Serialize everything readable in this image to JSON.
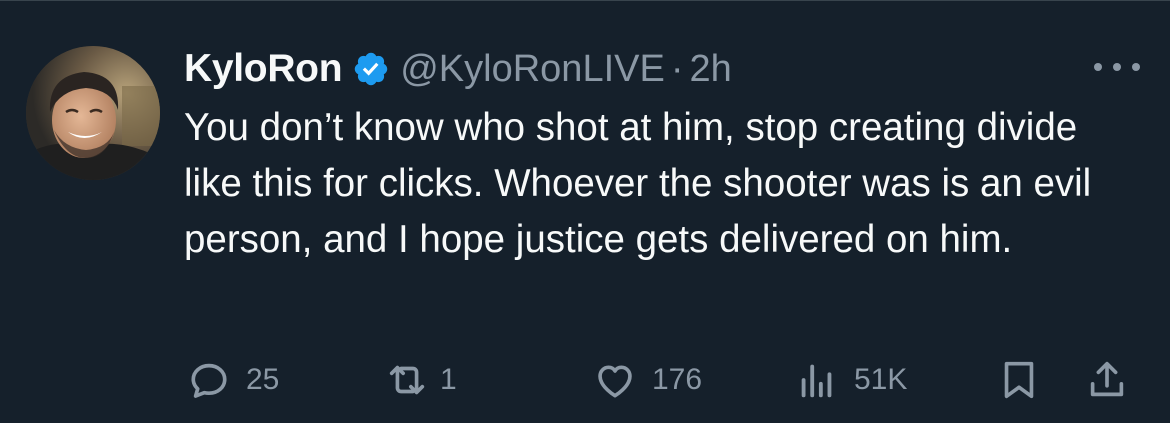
{
  "tweet": {
    "author": {
      "display_name": "KyloRon",
      "handle": "@KyloRonLIVE",
      "verified": true,
      "verified_color": "#1d9bf0"
    },
    "separator": "·",
    "timestamp": "2h",
    "text": "You don’t know who shot at him, stop creating divide like this for clicks. Whoever the shooter was is an evil person, and I hope justice gets delivered on him.",
    "actions": {
      "replies": "25",
      "reposts": "1",
      "likes": "176",
      "views": "51K"
    }
  },
  "theme": {
    "background": "#15202b",
    "text_primary": "#f7f9f9",
    "text_secondary": "#8b98a5"
  }
}
